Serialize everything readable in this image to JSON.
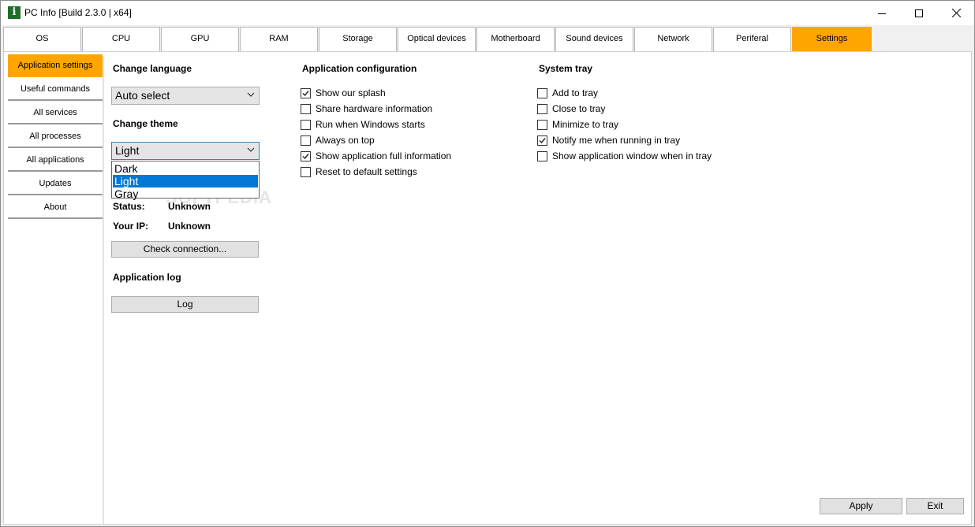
{
  "window": {
    "title": "PC Info [Build 2.3.0 | x64]",
    "icon_glyph": "i"
  },
  "tabs": [
    {
      "label": "OS"
    },
    {
      "label": "CPU"
    },
    {
      "label": "GPU"
    },
    {
      "label": "RAM"
    },
    {
      "label": "Storage"
    },
    {
      "label": "Optical devices"
    },
    {
      "label": "Motherboard"
    },
    {
      "label": "Sound devices"
    },
    {
      "label": "Network"
    },
    {
      "label": "Periferal"
    },
    {
      "label": "Settings",
      "active": true
    }
  ],
  "sidebar": [
    {
      "label": "Application settings",
      "active": true
    },
    {
      "label": "Useful commands"
    },
    {
      "label": "All services"
    },
    {
      "label": "All processes"
    },
    {
      "label": "All applications"
    },
    {
      "label": "Updates"
    },
    {
      "label": "About"
    }
  ],
  "language": {
    "heading": "Change language",
    "value": "Auto select"
  },
  "theme": {
    "heading": "Change theme",
    "value": "Light",
    "options": [
      "Dark",
      "Light",
      "Gray"
    ],
    "selected": "Light"
  },
  "watermark": "SOFTPEDIA",
  "connection": {
    "status_label": "Status:",
    "status_value": "Unknown",
    "ip_label": "Your IP:",
    "ip_value": "Unknown",
    "check_button": "Check connection..."
  },
  "log": {
    "heading": "Application log",
    "button": "Log"
  },
  "app_config": {
    "heading": "Application configuration",
    "options": [
      {
        "label": "Show our splash",
        "checked": true
      },
      {
        "label": "Share hardware information",
        "checked": false
      },
      {
        "label": "Run when Windows starts",
        "checked": false
      },
      {
        "label": "Always on top",
        "checked": false
      },
      {
        "label": "Show application full information",
        "checked": true
      },
      {
        "label": "Reset to default settings",
        "checked": false
      }
    ]
  },
  "tray": {
    "heading": "System tray",
    "options": [
      {
        "label": "Add to tray",
        "checked": false
      },
      {
        "label": "Close to tray",
        "checked": false
      },
      {
        "label": "Minimize to tray",
        "checked": false
      },
      {
        "label": "Notify me when running in tray",
        "checked": true
      },
      {
        "label": "Show application window when in tray",
        "checked": false
      }
    ]
  },
  "footer": {
    "apply": "Apply",
    "exit": "Exit"
  },
  "colors": {
    "accent": "#ffa500",
    "selection": "#0078d7",
    "app_icon": "#1f6e2a"
  }
}
